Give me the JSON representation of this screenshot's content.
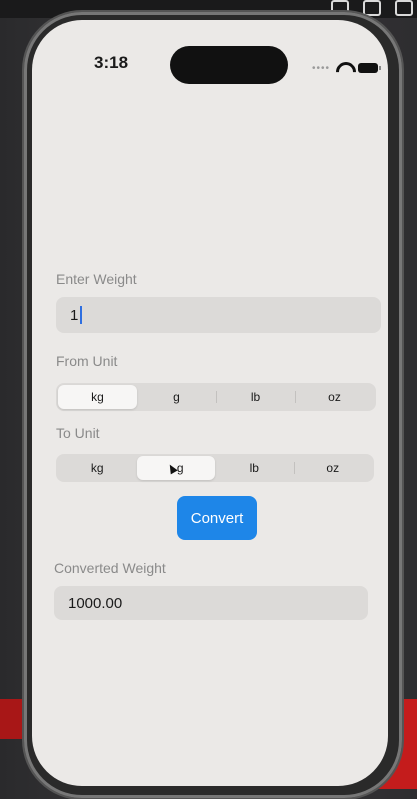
{
  "status_bar": {
    "time": "3:18",
    "signal_icon": "signal-dots-icon",
    "wifi_icon": "wifi-icon",
    "battery_icon": "battery-icon"
  },
  "form": {
    "weight_label": "Enter Weight",
    "weight_value": "1",
    "from_label": "From Unit",
    "to_label": "To Unit",
    "units": [
      "kg",
      "g",
      "lb",
      "oz"
    ],
    "from_selected": "kg",
    "to_selected": "g",
    "convert_label": "Convert",
    "result_label": "Converted Weight",
    "result_value": "1000.00"
  },
  "colors": {
    "accent": "#1e86e8",
    "background": "#ebe9e7",
    "field": "#dcdad8"
  }
}
